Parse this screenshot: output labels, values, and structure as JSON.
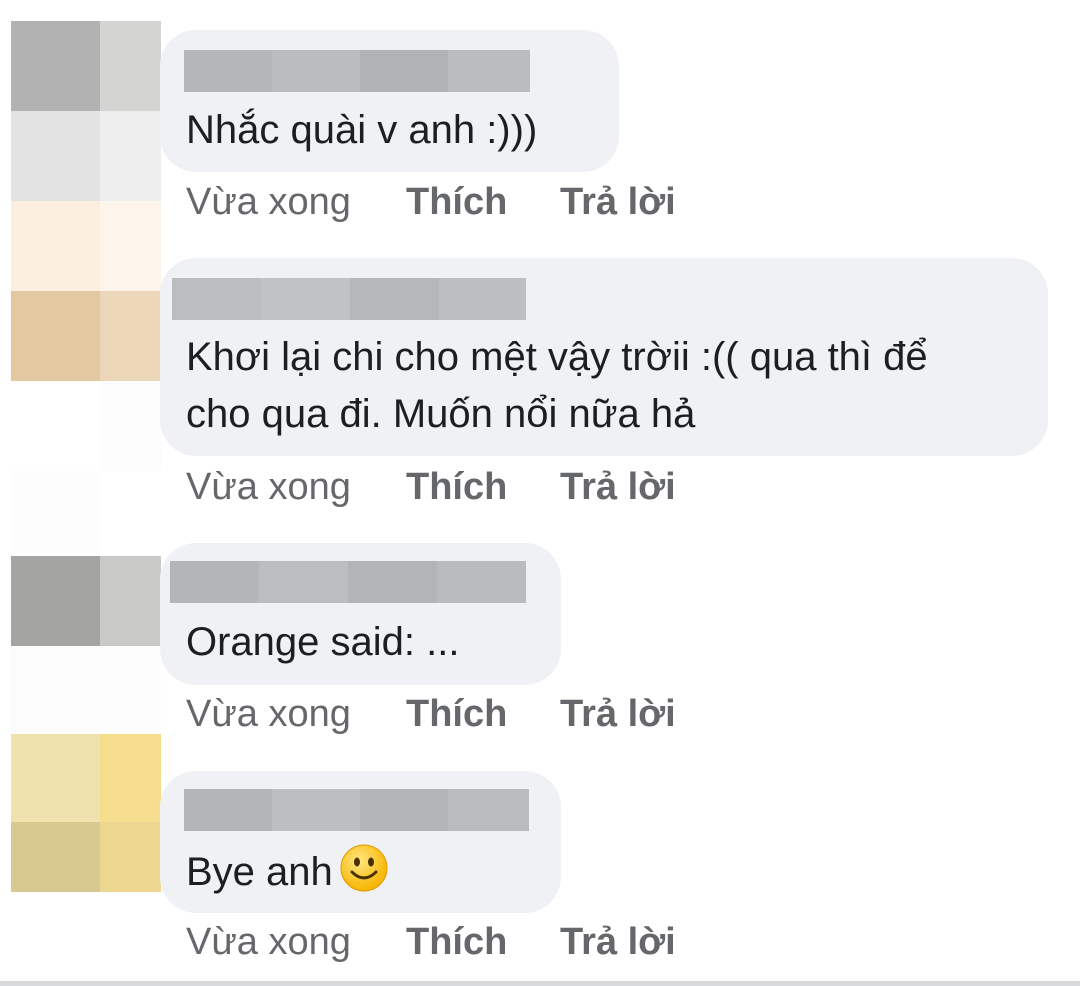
{
  "comments": [
    {
      "author_name": "",
      "text_lines": [
        "Nhắc quài v anh :)))"
      ],
      "time": "Vừa xong",
      "like_label": "Thích",
      "reply_label": "Trả lời"
    },
    {
      "author_name": "",
      "text_lines": [
        "Khơi lại chi cho mệt vậy trờii :(( qua thì để",
        "cho qua đi. Muốn nổi nữa hả"
      ],
      "time": "Vừa xong",
      "like_label": "Thích",
      "reply_label": "Trả lời"
    },
    {
      "author_name": "",
      "text_lines": [
        "Orange said: ..."
      ],
      "time": "Vừa xong",
      "like_label": "Thích",
      "reply_label": "Trả lời"
    },
    {
      "author_name": "",
      "text_lines": [
        "Bye anh"
      ],
      "emoji": "smiling-face-emoji",
      "time": "Vừa xong",
      "like_label": "Thích",
      "reply_label": "Trả lời"
    }
  ],
  "colors": {
    "bubble_bg": "#eff1f5",
    "action_text": "#65676b",
    "comment_text": "#1c1e21",
    "name_redaction": "#b3b4b8"
  }
}
